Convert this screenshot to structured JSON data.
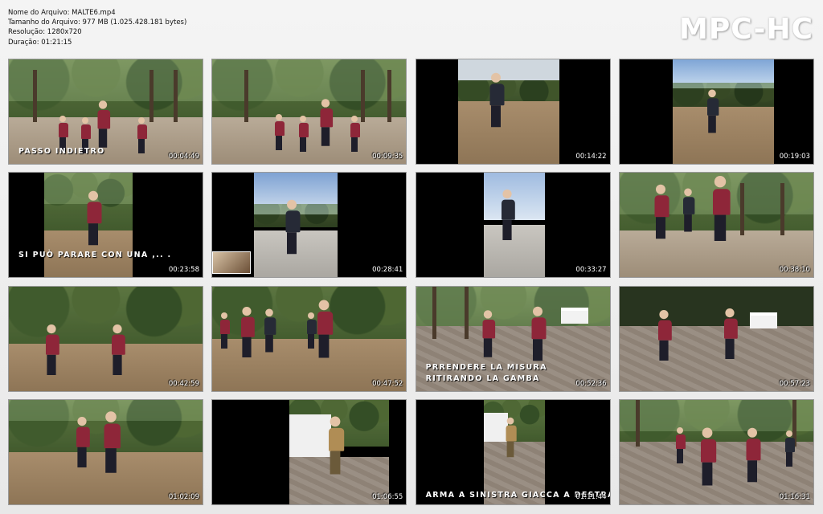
{
  "info": {
    "line1": "Nome do Arquivo: MALTE6.mp4",
    "line2": "Tamanho do Arquivo: 977 MB (1.025.428.181 bytes)",
    "line3": "Resolução: 1280x720",
    "line4": "Duração: 01:21:15"
  },
  "logo": "MPC-HC",
  "thumbs": [
    {
      "time": "00:04:49",
      "caption": "PASSO INDIETRO"
    },
    {
      "time": "00:09:35",
      "caption": ""
    },
    {
      "time": "00:14:22",
      "caption": ""
    },
    {
      "time": "00:19:03",
      "caption": ""
    },
    {
      "time": "00:23:58",
      "caption": "SI PUÒ PARARE CON UNA ,.. ."
    },
    {
      "time": "00:28:41",
      "caption": ""
    },
    {
      "time": "00:33:27",
      "caption": ""
    },
    {
      "time": "00:38:10",
      "caption": ""
    },
    {
      "time": "00:42:59",
      "caption": ""
    },
    {
      "time": "00:47:52",
      "caption": ""
    },
    {
      "time": "00:52:36",
      "caption": "PRRENDERE LA MISURA RITIRANDO LA GAMBA"
    },
    {
      "time": "00:57:23",
      "caption": ""
    },
    {
      "time": "01:02:09",
      "caption": ""
    },
    {
      "time": "01:06:55",
      "caption": ""
    },
    {
      "time": "01:11:44",
      "caption": "ARMA A SINISTRA GIACCA A DESTRA"
    },
    {
      "time": "01:16:31",
      "caption": ""
    }
  ]
}
